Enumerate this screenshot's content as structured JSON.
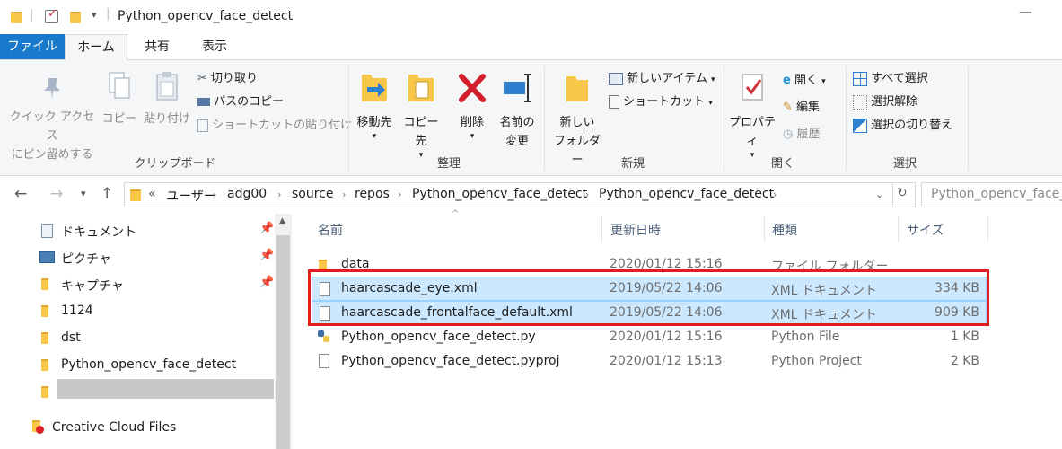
{
  "window": {
    "title": "Python_opencv_face_detect",
    "minimize_label": "—",
    "quick_access_dropdown": "▾"
  },
  "ribbon_tabs": [
    "ファイル",
    "ホーム",
    "共有",
    "表示"
  ],
  "ribbon": {
    "clipboard": {
      "pin_label_1": "クイック アクセス",
      "pin_label_2": "にピン留めする",
      "copy": "コピー",
      "paste": "貼り付け",
      "cut": "切り取り",
      "copy_path": "パスのコピー",
      "paste_shortcut": "ショートカットの貼り付け",
      "group": "クリップボード"
    },
    "organize": {
      "move_to": "移動先",
      "copy_to": "コピー先",
      "delete": "削除",
      "rename_1": "名前の",
      "rename_2": "変更",
      "group": "整理"
    },
    "new": {
      "new_item": "新しいアイテム",
      "shortcut": "ショートカット",
      "new_folder_1": "新しい",
      "new_folder_2": "フォルダー",
      "group": "新規"
    },
    "open": {
      "properties": "プロパティ",
      "open": "開く",
      "edit": "編集",
      "history": "履歴",
      "group": "開く"
    },
    "select": {
      "select_all": "すべて選択",
      "select_none": "選択解除",
      "invert": "選択の切り替え",
      "group": "選択"
    }
  },
  "address": {
    "overflow": "«",
    "crumbs": [
      "ユーザー",
      "adg00",
      "source",
      "repos",
      "Python_opencv_face_detect",
      "Python_opencv_face_detect"
    ],
    "search_placeholder": "Python_opencv_face_d"
  },
  "nav": {
    "items": [
      {
        "label": "ドキュメント",
        "icon": "documents-icon",
        "pinned": true
      },
      {
        "label": "ピクチャ",
        "icon": "pictures-icon",
        "pinned": true
      },
      {
        "label": "キャプチャ",
        "icon": "folder-icon",
        "pinned": true
      },
      {
        "label": "1124",
        "icon": "folder-icon",
        "pinned": false
      },
      {
        "label": "dst",
        "icon": "folder-icon",
        "pinned": false
      },
      {
        "label": "Python_opencv_face_detect",
        "icon": "folder-icon",
        "pinned": false
      },
      {
        "label": "",
        "icon": "folder-icon",
        "pinned": false
      },
      {
        "label": "Creative Cloud Files",
        "icon": "creative-cloud-icon",
        "pinned": false
      }
    ],
    "pin_glyph": "📌"
  },
  "columns": [
    "名前",
    "更新日時",
    "種類",
    "サイズ"
  ],
  "files": [
    {
      "name": "data",
      "modified": "2020/01/12 15:16",
      "type": "ファイル フォルダー",
      "size": "",
      "icon": "folder-icon",
      "selected": false
    },
    {
      "name": "haarcascade_eye.xml",
      "modified": "2019/05/22 14:06",
      "type": "XML ドキュメント",
      "size": "334 KB",
      "icon": "file-icon",
      "selected": true
    },
    {
      "name": "haarcascade_frontalface_default.xml",
      "modified": "2019/05/22 14:06",
      "type": "XML ドキュメント",
      "size": "909 KB",
      "icon": "file-icon",
      "selected": true
    },
    {
      "name": "Python_opencv_face_detect.py",
      "modified": "2020/01/12 15:16",
      "type": "Python File",
      "size": "1 KB",
      "icon": "python-file-icon",
      "selected": false
    },
    {
      "name": "Python_opencv_face_detect.pyproj",
      "modified": "2020/01/12 15:13",
      "type": "Python Project",
      "size": "2 KB",
      "icon": "file-icon",
      "selected": false
    }
  ],
  "colors": {
    "accent": "#1979ca",
    "selection": "#cce8ff",
    "highlight_border": "#e0201c",
    "folder": "#f8c74a"
  }
}
